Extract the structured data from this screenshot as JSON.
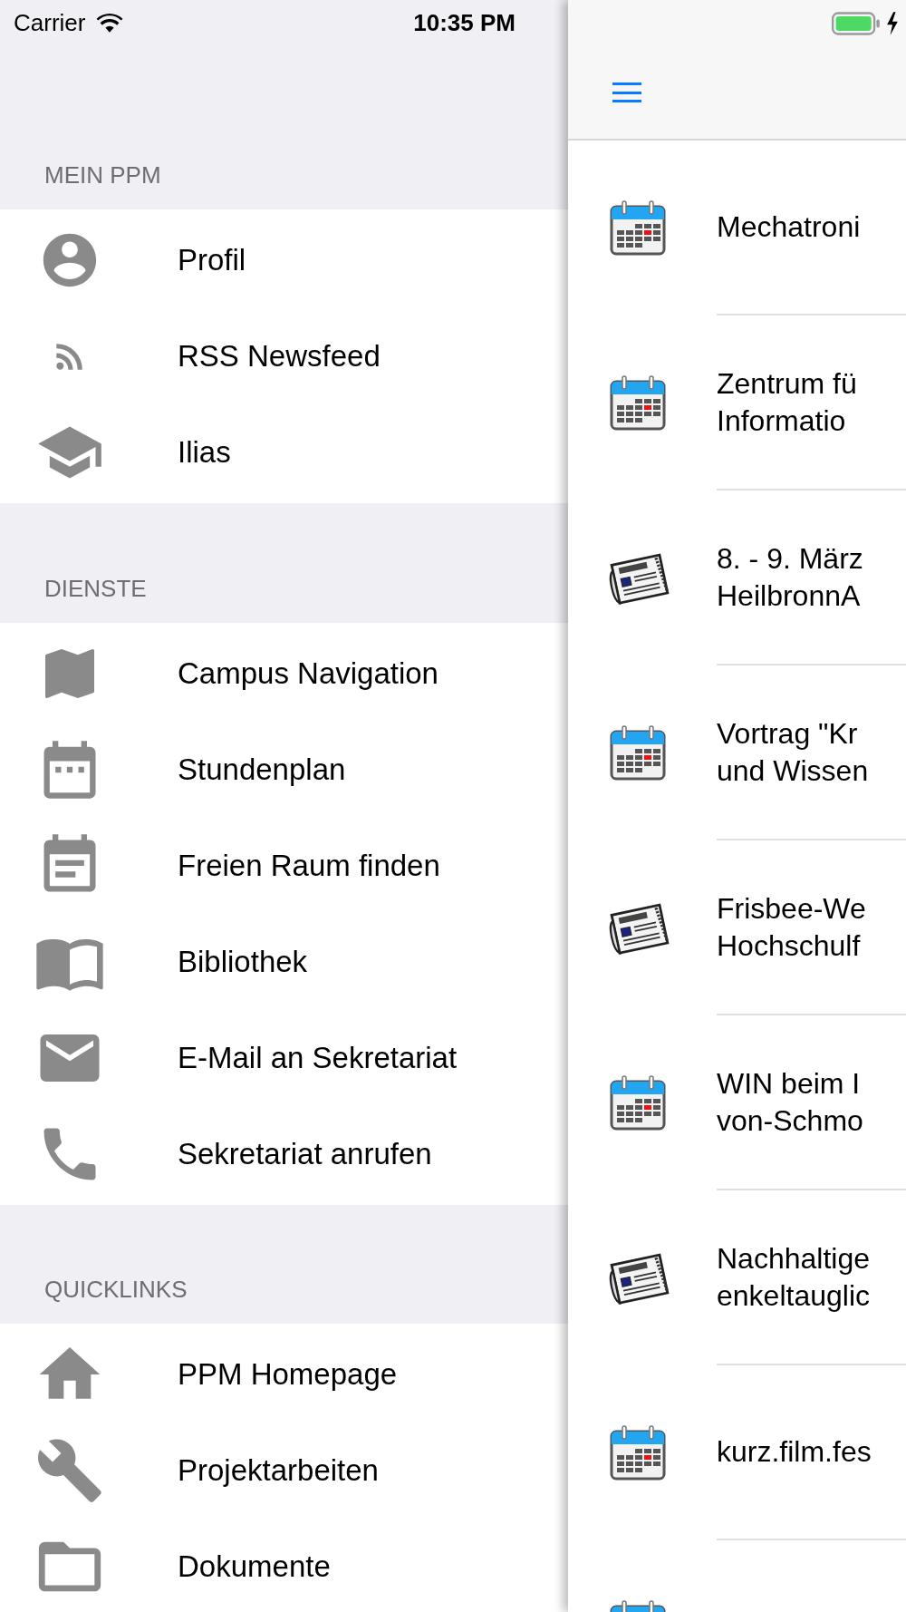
{
  "status_bar": {
    "carrier": "Carrier",
    "time": "10:35 PM",
    "charging": true
  },
  "drawer": {
    "sections": [
      {
        "title": "MEIN PPM",
        "items": [
          {
            "label": "Profil"
          },
          {
            "label": "RSS Newsfeed"
          },
          {
            "label": "Ilias"
          }
        ]
      },
      {
        "title": "DIENSTE",
        "items": [
          {
            "label": "Campus Navigation"
          },
          {
            "label": "Stundenplan"
          },
          {
            "label": "Freien Raum finden"
          },
          {
            "label": "Bibliothek"
          },
          {
            "label": "E-Mail an Sekretariat"
          },
          {
            "label": "Sekretariat anrufen"
          }
        ]
      },
      {
        "title": "QUICKLINKS",
        "items": [
          {
            "label": "PPM Homepage"
          },
          {
            "label": "Projektarbeiten"
          },
          {
            "label": "Dokumente"
          }
        ]
      }
    ]
  },
  "feed": {
    "items": [
      {
        "kind": "event",
        "lines": [
          "Mechatroni"
        ]
      },
      {
        "kind": "event",
        "lines": [
          "Zentrum fü",
          "Informatio"
        ]
      },
      {
        "kind": "news",
        "lines": [
          "8. - 9. März",
          "HeilbronnA"
        ]
      },
      {
        "kind": "event",
        "lines": [
          "Vortrag \"Kr",
          "und Wissen"
        ]
      },
      {
        "kind": "news",
        "lines": [
          "Frisbee-We",
          "Hochschulf"
        ]
      },
      {
        "kind": "event",
        "lines": [
          "WIN beim I",
          "von-Schmo"
        ]
      },
      {
        "kind": "news",
        "lines": [
          "Nachhaltige",
          "enkeltauglic"
        ]
      },
      {
        "kind": "event",
        "lines": [
          "kurz.film.fes"
        ]
      },
      {
        "kind": "event"
      }
    ]
  }
}
